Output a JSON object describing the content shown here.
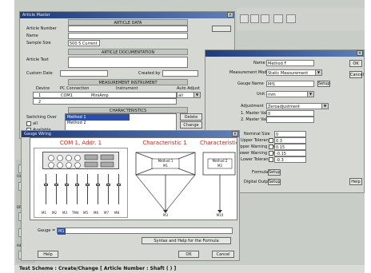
{
  "article_window": {
    "title": "Article Master",
    "sections": {
      "article_data": "ARTICLE DATA",
      "article_documentation": "ARTICLE DOCUMENTATION",
      "measurement_instrument": "MEASUREMENT INSTRUMENT",
      "characteristics": "CHARACTERISTICS"
    },
    "labels": {
      "article_number": "Article Number",
      "name": "Name",
      "sample_size": "Sample Size",
      "article_text": "Article Text",
      "custom_date": "Custom Date",
      "created_by": "Created by",
      "device": "Device",
      "pc_connection": "PC Connection",
      "instrument": "Instrument",
      "auto_adjust": "Auto Adjust",
      "switching_over": "Switching Over",
      "all": "all",
      "available": "Available"
    },
    "values": {
      "sample_size": "500 5 Current"
    },
    "instrument_rows": [
      {
        "device": "1",
        "pc_connection": "COM1",
        "instrument": "MiniAmp"
      },
      {
        "device": "2",
        "pc_connection": "",
        "instrument": ""
      }
    ],
    "auto_adjust_value": "all",
    "characteristics_list": [
      "Method 1",
      "Method 2"
    ],
    "buttons": {
      "delete": "Delete",
      "change": "Change"
    }
  },
  "characteristic_window": {
    "labels": {
      "name": "Name",
      "measurement_mode": "Measurement Mode",
      "gauge_name": "Gauge Name",
      "unit": "Unit",
      "adjustment": "Adjustment",
      "master_value_1": "1. Master Value",
      "master_value_2": "2. Master Value",
      "nominal_size": "Nominal Size",
      "upper_tolerance": "Upper Tolerance",
      "upper_warning_limit": "Upper Warning Limit",
      "lower_warning_limit": "Lower Warning Limit",
      "lower_tolerance": "Lower Tolerance",
      "formula": "Formula",
      "digital_output": "Digital Output"
    },
    "values": {
      "name": "Method F",
      "measurement_mode": "Static Measurement",
      "gauge_name": "Mf1",
      "unit": "mm",
      "adjustment": "Zeroadjustment",
      "master_value_1": "0",
      "master_value_2": "",
      "nominal_size": "0",
      "upper_tolerance": "0.3",
      "upper_warning_limit": "0.15",
      "lower_warning_limit": "-0.15",
      "lower_tolerance": "-0.3"
    },
    "buttons": {
      "ok": "OK",
      "cancel": "Cancel",
      "help": "Help",
      "setup": "Setup"
    }
  },
  "gauge_window": {
    "title": "Gauge Wiring",
    "panel1_title": "COM 1, Addr. 1",
    "panel2_title": "Characteristic 1",
    "panel3_title": "Characteristic",
    "channels": [
      "M1",
      "M2",
      "M3",
      "TM4",
      "M5",
      "M6",
      "M7",
      "M8"
    ],
    "char1": {
      "method": "Method 1",
      "sub": "M1",
      "bottom": "M3"
    },
    "char2": {
      "method": "Method 2",
      "sub": "M2",
      "bottom": "M10"
    },
    "gauge_label": "Gauge =",
    "gauge_value": "M1",
    "buttons": {
      "syntax_help": "Syntax and Help for the Formula",
      "ok": "OK",
      "cancel": "Cancel",
      "help": "Help"
    }
  },
  "side_panel": {
    "labels": [
      "Video/C",
      "DRO-Bo",
      "Addition"
    ]
  },
  "status_bar": {
    "text": "Test Scheme : Create/Change  [  Article Number : Shaft  ( ) ]"
  }
}
